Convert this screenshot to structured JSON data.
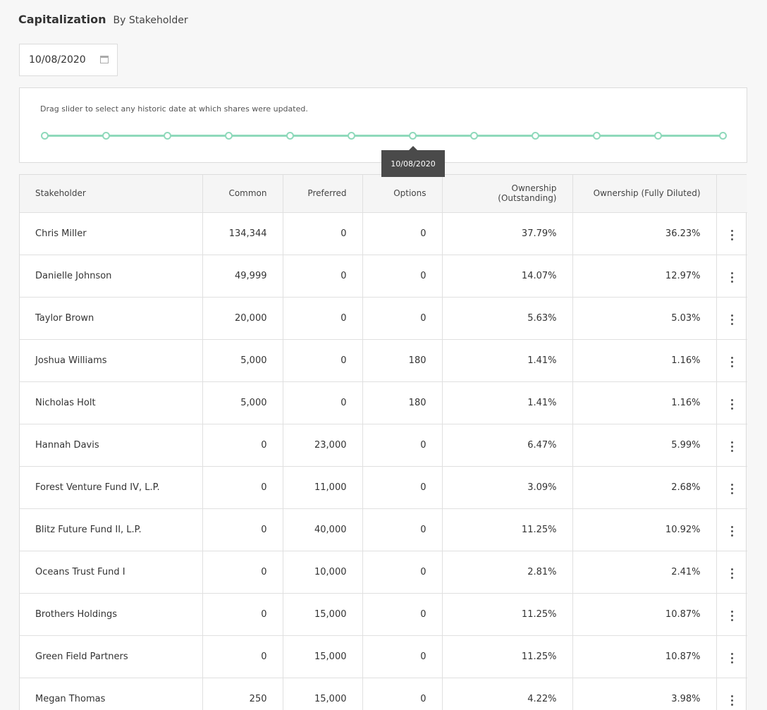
{
  "header": {
    "title": "Capitalization",
    "subtitle": "By Stakeholder"
  },
  "date_picker": {
    "value": "10/08/2020",
    "icon": "calendar-icon"
  },
  "slider": {
    "hint": "Drag slider to select any historic date at which shares were updated.",
    "tooltip": "10/08/2020",
    "accent_color": "#8fd9bb",
    "stop_count": 12,
    "selected_index": 6
  },
  "table": {
    "columns": [
      "Stakeholder",
      "Common",
      "Preferred",
      "Options",
      "Ownership (Outstanding)",
      "Ownership (Fully Diluted)",
      ""
    ],
    "rows": [
      {
        "name": "Chris Miller",
        "common": "134,344",
        "preferred": "0",
        "options": "0",
        "outstanding": "37.79%",
        "diluted": "36.23%"
      },
      {
        "name": "Danielle Johnson",
        "common": "49,999",
        "preferred": "0",
        "options": "0",
        "outstanding": "14.07%",
        "diluted": "12.97%"
      },
      {
        "name": "Taylor Brown",
        "common": "20,000",
        "preferred": "0",
        "options": "0",
        "outstanding": "5.63%",
        "diluted": "5.03%"
      },
      {
        "name": "Joshua Williams",
        "common": "5,000",
        "preferred": "0",
        "options": "180",
        "outstanding": "1.41%",
        "diluted": "1.16%"
      },
      {
        "name": "Nicholas Holt",
        "common": "5,000",
        "preferred": "0",
        "options": "180",
        "outstanding": "1.41%",
        "diluted": "1.16%"
      },
      {
        "name": "Hannah Davis",
        "common": "0",
        "preferred": "23,000",
        "options": "0",
        "outstanding": "6.47%",
        "diluted": "5.99%"
      },
      {
        "name": "Forest Venture Fund IV, L.P.",
        "common": "0",
        "preferred": "11,000",
        "options": "0",
        "outstanding": "3.09%",
        "diluted": "2.68%"
      },
      {
        "name": "Blitz Future Fund II, L.P.",
        "common": "0",
        "preferred": "40,000",
        "options": "0",
        "outstanding": "11.25%",
        "diluted": "10.92%"
      },
      {
        "name": "Oceans Trust Fund I",
        "common": "0",
        "preferred": "10,000",
        "options": "0",
        "outstanding": "2.81%",
        "diluted": "2.41%"
      },
      {
        "name": "Brothers Holdings",
        "common": "0",
        "preferred": "15,000",
        "options": "0",
        "outstanding": "11.25%",
        "diluted": "10.87%"
      },
      {
        "name": "Green Field Partners",
        "common": "0",
        "preferred": "15,000",
        "options": "0",
        "outstanding": "11.25%",
        "diluted": "10.87%"
      },
      {
        "name": "Megan Thomas",
        "common": "250",
        "preferred": "15,000",
        "options": "0",
        "outstanding": "4.22%",
        "diluted": "3.98%"
      }
    ]
  }
}
